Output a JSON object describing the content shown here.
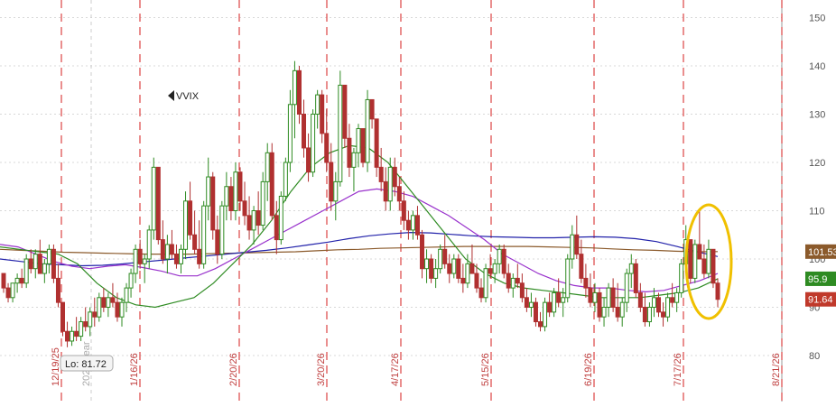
{
  "chart_data": {
    "type": "candlestick",
    "symbol": "VVIX",
    "ylim": [
      75,
      155
    ],
    "y_ticks": [
      80,
      90,
      100,
      110,
      120,
      130,
      140,
      150
    ],
    "x_labels": [
      "12/19/25",
      "1/16/26",
      "2/20/26",
      "3/20/26",
      "4/17/26",
      "5/15/26",
      "6/19/26",
      "7/17/26",
      "8/21/26"
    ],
    "extra_label": "2026 Year",
    "low_label": "Lo: 81.72",
    "price_tags": [
      {
        "text": "101.53",
        "value": 101.53,
        "color": "#8b5a2b"
      },
      {
        "text": "95.9",
        "value": 95.9,
        "color": "#2e8b22"
      },
      {
        "text": "91.64",
        "value": 91.64,
        "color": "#c0392b"
      }
    ],
    "candles": [
      [
        97,
        97,
        93,
        94
      ],
      [
        94,
        95,
        91,
        92
      ],
      [
        92,
        95,
        91,
        95
      ],
      [
        95,
        97,
        93,
        96
      ],
      [
        96,
        98,
        94,
        95
      ],
      [
        95,
        101,
        94,
        100
      ],
      [
        100,
        102,
        97,
        98
      ],
      [
        98,
        102,
        96,
        101
      ],
      [
        101,
        104,
        97,
        97
      ],
      [
        97,
        100,
        95,
        99
      ],
      [
        99,
        103,
        97,
        102
      ],
      [
        102,
        103,
        95,
        96
      ],
      [
        96,
        99,
        90,
        91
      ],
      [
        91,
        91,
        84,
        85
      ],
      [
        85,
        87,
        81.72,
        83
      ],
      [
        83,
        86,
        82,
        85
      ],
      [
        85,
        88,
        83,
        84
      ],
      [
        84,
        88,
        83,
        87
      ],
      [
        87,
        90,
        85,
        86
      ],
      [
        86,
        90,
        84,
        89
      ],
      [
        89,
        92,
        86,
        88
      ],
      [
        88,
        93,
        87,
        92
      ],
      [
        92,
        94,
        89,
        90
      ],
      [
        90,
        93,
        88,
        92
      ],
      [
        92,
        95,
        90,
        91
      ],
      [
        91,
        93,
        87,
        88
      ],
      [
        88,
        92,
        86,
        91
      ],
      [
        91,
        95,
        89,
        94
      ],
      [
        94,
        98,
        92,
        97
      ],
      [
        97,
        103,
        95,
        102
      ],
      [
        102,
        104,
        98,
        99
      ],
      [
        99,
        101,
        95,
        100
      ],
      [
        100,
        107,
        98,
        106
      ],
      [
        106,
        121,
        104,
        119
      ],
      [
        119,
        114,
        103,
        104
      ],
      [
        104,
        108,
        99,
        100
      ],
      [
        100,
        105,
        97,
        103
      ],
      [
        103,
        106,
        100,
        101
      ],
      [
        101,
        103,
        98,
        99
      ],
      [
        99,
        103,
        97,
        102
      ],
      [
        102,
        114,
        100,
        112
      ],
      [
        112,
        116,
        104,
        105
      ],
      [
        105,
        110,
        101,
        102
      ],
      [
        102,
        108,
        98,
        99
      ],
      [
        99,
        112,
        98,
        111
      ],
      [
        111,
        121,
        108,
        117
      ],
      [
        117,
        118,
        104,
        106
      ],
      [
        106,
        109,
        99,
        101
      ],
      [
        101,
        112,
        100,
        111
      ],
      [
        111,
        118,
        108,
        115
      ],
      [
        115,
        117,
        108,
        110
      ],
      [
        110,
        120,
        108,
        118
      ],
      [
        118,
        119,
        110,
        112
      ],
      [
        112,
        116,
        107,
        109
      ],
      [
        109,
        113,
        104,
        106
      ],
      [
        106,
        111,
        103,
        110
      ],
      [
        110,
        114,
        105,
        107
      ],
      [
        107,
        118,
        106,
        116
      ],
      [
        116,
        124,
        112,
        122
      ],
      [
        122,
        124,
        108,
        109
      ],
      [
        109,
        112,
        101,
        104
      ],
      [
        104,
        114,
        103,
        113
      ],
      [
        113,
        121,
        112,
        120
      ],
      [
        120,
        135,
        118,
        132
      ],
      [
        132,
        141,
        125,
        139
      ],
      [
        139,
        140,
        128,
        130
      ],
      [
        130,
        133,
        121,
        123
      ],
      [
        123,
        126,
        116,
        118
      ],
      [
        118,
        131,
        117,
        130
      ],
      [
        130,
        135,
        127,
        134
      ],
      [
        134,
        135,
        124,
        126
      ],
      [
        126,
        131,
        118,
        120
      ],
      [
        120,
        124,
        110,
        112
      ],
      [
        112,
        118,
        108,
        116
      ],
      [
        116,
        139,
        115,
        136
      ],
      [
        136,
        133,
        123,
        125
      ],
      [
        125,
        128,
        117,
        119
      ],
      [
        119,
        123,
        114,
        122
      ],
      [
        122,
        128,
        119,
        127
      ],
      [
        127,
        127,
        119,
        120
      ],
      [
        120,
        135,
        118,
        133
      ],
      [
        133,
        132,
        127,
        129
      ],
      [
        129,
        124,
        117,
        119
      ],
      [
        119,
        123,
        114,
        116
      ],
      [
        116,
        119,
        110,
        112
      ],
      [
        112,
        121,
        110,
        119
      ],
      [
        119,
        121,
        113,
        115
      ],
      [
        115,
        117,
        110,
        112
      ],
      [
        112,
        114,
        106,
        108
      ],
      [
        108,
        110,
        104,
        106
      ],
      [
        106,
        110,
        104,
        109
      ],
      [
        109,
        111,
        104,
        105
      ],
      [
        105,
        106,
        96,
        98
      ],
      [
        98,
        102,
        95,
        100
      ],
      [
        100,
        101,
        95,
        96
      ],
      [
        96,
        100,
        94,
        98
      ],
      [
        98,
        103,
        97,
        102
      ],
      [
        102,
        105,
        98,
        99
      ],
      [
        99,
        101,
        95,
        97
      ],
      [
        97,
        101,
        96,
        100
      ],
      [
        100,
        101,
        95,
        96
      ],
      [
        96,
        99,
        93,
        95
      ],
      [
        95,
        101,
        94,
        99
      ],
      [
        99,
        103,
        97,
        97
      ],
      [
        97,
        99,
        93,
        94
      ],
      [
        94,
        96,
        91,
        92
      ],
      [
        92,
        99,
        91,
        98
      ],
      [
        98,
        101,
        96,
        97
      ],
      [
        97,
        100,
        95,
        99
      ],
      [
        99,
        103,
        97,
        102
      ],
      [
        102,
        103,
        96,
        97
      ],
      [
        97,
        99,
        93,
        94
      ],
      [
        94,
        97,
        92,
        96
      ],
      [
        96,
        99,
        94,
        95
      ],
      [
        95,
        97,
        91,
        92
      ],
      [
        92,
        94,
        89,
        90
      ],
      [
        90,
        93,
        88,
        91
      ],
      [
        91,
        92,
        86,
        87
      ],
      [
        87,
        89,
        85,
        86
      ],
      [
        86,
        92,
        85,
        91
      ],
      [
        91,
        93,
        88,
        89
      ],
      [
        89,
        94,
        88,
        93
      ],
      [
        93,
        96,
        90,
        91
      ],
      [
        91,
        94,
        88,
        92
      ],
      [
        92,
        101,
        91,
        100
      ],
      [
        100,
        107,
        98,
        105
      ],
      [
        105,
        109,
        100,
        101
      ],
      [
        101,
        104,
        95,
        96
      ],
      [
        96,
        99,
        92,
        94
      ],
      [
        94,
        97,
        90,
        91
      ],
      [
        91,
        95,
        89,
        93
      ],
      [
        93,
        94,
        87,
        88
      ],
      [
        88,
        92,
        86,
        90
      ],
      [
        90,
        95,
        88,
        94
      ],
      [
        94,
        96,
        89,
        90
      ],
      [
        90,
        95,
        87,
        88
      ],
      [
        88,
        92,
        86,
        91
      ],
      [
        91,
        98,
        89,
        97
      ],
      [
        97,
        101,
        94,
        99
      ],
      [
        99,
        100,
        92,
        93
      ],
      [
        93,
        95,
        89,
        90
      ],
      [
        90,
        93,
        86,
        87
      ],
      [
        87,
        91,
        86,
        90
      ],
      [
        90,
        94,
        88,
        92
      ],
      [
        92,
        93,
        88,
        89
      ],
      [
        89,
        91,
        86,
        88
      ],
      [
        88,
        93,
        87,
        92
      ],
      [
        92,
        95,
        90,
        91
      ],
      [
        91,
        94,
        89,
        93
      ],
      [
        93,
        100,
        92,
        99
      ],
      [
        99,
        107,
        97,
        104
      ],
      [
        104,
        101,
        95,
        96
      ],
      [
        96,
        104,
        95,
        103
      ],
      [
        103,
        110,
        100,
        100
      ],
      [
        100,
        103,
        96,
        97
      ],
      [
        97,
        104,
        96,
        102
      ],
      [
        102,
        100,
        94,
        95
      ],
      [
        95,
        96,
        90,
        91.64
      ]
    ],
    "series": [
      {
        "name": "",
        "color": "#8b5a2b",
        "values": [
          102,
          101.8,
          101.6,
          101.4,
          101.3,
          101.2,
          101.1,
          101,
          101,
          101,
          101.1,
          101.2,
          101.3,
          101.4,
          101.5,
          101.7,
          101.9,
          102,
          102.2,
          102.3,
          102.4,
          102.5,
          102.6,
          102.6,
          102.6,
          102.6,
          102.5,
          102.4,
          102.3,
          102.1,
          101.9,
          101.8,
          101.6,
          101.5,
          101.53
        ]
      },
      {
        "name": "",
        "color": "#2222aa",
        "values": [
          100,
          99.5,
          99,
          98.8,
          98.6,
          98.7,
          99,
          99.4,
          99.8,
          100.2,
          100.6,
          101,
          101.4,
          101.8,
          102.3,
          102.9,
          103.5,
          104.2,
          104.8,
          105.2,
          105.5,
          105.4,
          105.1,
          104.8,
          104.6,
          104.5,
          104.4,
          104.4,
          104.5,
          104.6,
          104.5,
          104.2,
          103.6,
          102.6,
          101.5,
          100.5
        ]
      },
      {
        "name": "",
        "color": "#9932cc",
        "values": [
          103,
          102.5,
          101,
          99.5,
          98.5,
          98,
          98.5,
          98.8,
          98.2,
          97.5,
          96.5,
          96.5,
          98,
          100,
          102,
          104,
          106,
          108,
          110,
          112,
          114,
          114.5,
          114,
          113,
          111,
          109,
          106.5,
          104,
          101,
          99,
          97,
          95.5,
          94.5,
          94,
          94,
          93.5,
          93.2,
          93.5,
          94.5,
          95.5,
          97
        ]
      },
      {
        "name": "",
        "color": "#2e8b22",
        "values": [
          102.5,
          102,
          101.5,
          101,
          99,
          95,
          92,
          90.5,
          90,
          91,
          92,
          95,
          99,
          103,
          108,
          114,
          119,
          122,
          123.5,
          123,
          120,
          115,
          110,
          105,
          100,
          97,
          95,
          94,
          93.5,
          93,
          92.5,
          92,
          92,
          92,
          92.5,
          93,
          94,
          95.9
        ]
      }
    ]
  }
}
